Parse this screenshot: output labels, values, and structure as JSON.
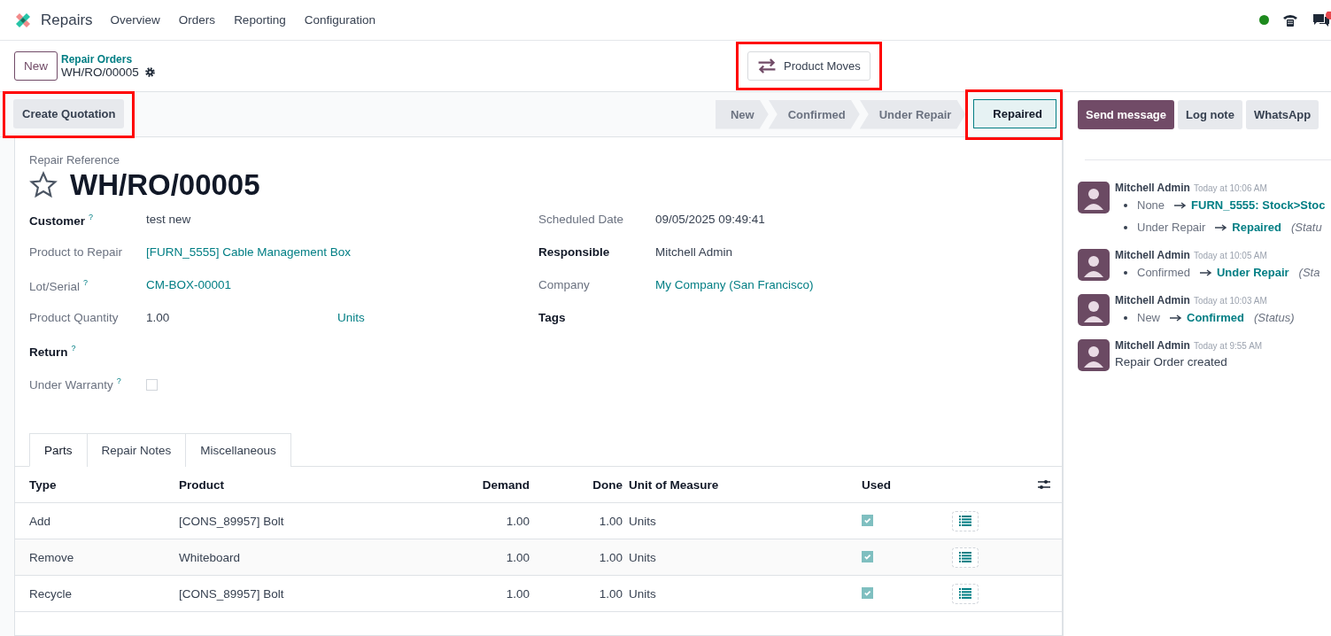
{
  "navbar": {
    "app_name": "Repairs",
    "menu": [
      "Overview",
      "Orders",
      "Reporting",
      "Configuration"
    ]
  },
  "control_panel": {
    "new_button": "New",
    "breadcrumb": "Repair Orders",
    "record": "WH/RO/00005",
    "smart_button": {
      "label": "Product Moves",
      "highlighted": true
    }
  },
  "action_bar": {
    "buttons": [
      {
        "label": "Create Quotation",
        "highlighted": true
      }
    ],
    "stages": [
      {
        "label": "New",
        "selected": false,
        "highlighted": false
      },
      {
        "label": "Confirmed",
        "selected": false,
        "highlighted": false
      },
      {
        "label": "Under Repair",
        "selected": false,
        "highlighted": false
      },
      {
        "label": "Repaired",
        "selected": true,
        "highlighted": true
      }
    ]
  },
  "chatter_buttons": [
    {
      "label": "Send message",
      "kind": "primary"
    },
    {
      "label": "Log note",
      "kind": "secondary"
    },
    {
      "label": "WhatsApp",
      "kind": "secondary"
    }
  ],
  "form": {
    "reference_label": "Repair Reference",
    "reference": "WH/RO/00005",
    "starred": false,
    "left_fields": [
      {
        "label": "Customer",
        "required": true,
        "help": "?",
        "kind": "text",
        "value": "test new"
      },
      {
        "label": "Product to Repair",
        "required": false,
        "kind": "link",
        "value": "[FURN_5555] Cable Management Box"
      },
      {
        "label": "Lot/Serial",
        "required": false,
        "help": "?",
        "kind": "link",
        "value": "CM-BOX-00001"
      },
      {
        "label": "Product Quantity",
        "required": false,
        "kind": "quantity",
        "value": "1.00",
        "unit": "Units"
      },
      {
        "label": "Return",
        "required": true,
        "help": "?",
        "kind": "empty"
      },
      {
        "label": "Under Warranty",
        "required": false,
        "help": "?",
        "kind": "checkbox",
        "checked": false
      }
    ],
    "right_fields": [
      {
        "label": "Scheduled Date",
        "required": false,
        "kind": "text",
        "value": "09/05/2025 09:49:41"
      },
      {
        "label": "Responsible",
        "required": true,
        "kind": "text",
        "value": "Mitchell Admin"
      },
      {
        "label": "Company",
        "required": false,
        "kind": "link",
        "value": "My Company (San Francisco)"
      },
      {
        "label": "Tags",
        "required": true,
        "kind": "empty"
      }
    ],
    "tabs": [
      {
        "label": "Parts",
        "selected": true
      },
      {
        "label": "Repair Notes",
        "selected": false
      },
      {
        "label": "Miscellaneous",
        "selected": false
      }
    ],
    "table": {
      "columns": [
        "Type",
        "Product",
        "Demand",
        "Done",
        "Unit of Measure",
        "Used"
      ],
      "rows": [
        {
          "type": "Add",
          "product": "[CONS_89957] Bolt",
          "demand": "1.00",
          "done": "1.00",
          "uom": "Units",
          "used": true
        },
        {
          "type": "Remove",
          "product": "Whiteboard",
          "demand": "1.00",
          "done": "1.00",
          "uom": "Units",
          "used": true
        },
        {
          "type": "Recycle",
          "product": "[CONS_89957] Bolt",
          "demand": "1.00",
          "done": "1.00",
          "uom": "Units",
          "used": true
        }
      ]
    }
  },
  "chatter": {
    "messages": [
      {
        "author": "Mitchell Admin",
        "time": "Today at 10:06 AM",
        "changes": [
          {
            "from": "None",
            "to": "FURN_5555: Stock>Stoc"
          },
          {
            "from": "Under Repair",
            "to": "Repaired",
            "field": "(Statu"
          }
        ]
      },
      {
        "author": "Mitchell Admin",
        "time": "Today at 10:05 AM",
        "changes": [
          {
            "from": "Confirmed",
            "to": "Under Repair",
            "field": "(Sta"
          }
        ]
      },
      {
        "author": "Mitchell Admin",
        "time": "Today at 10:03 AM",
        "changes": [
          {
            "from": "New",
            "to": "Confirmed",
            "field": "(Status)"
          }
        ]
      },
      {
        "author": "Mitchell Admin",
        "time": "Today at 9:55 AM",
        "body": "Repair Order created"
      }
    ]
  }
}
